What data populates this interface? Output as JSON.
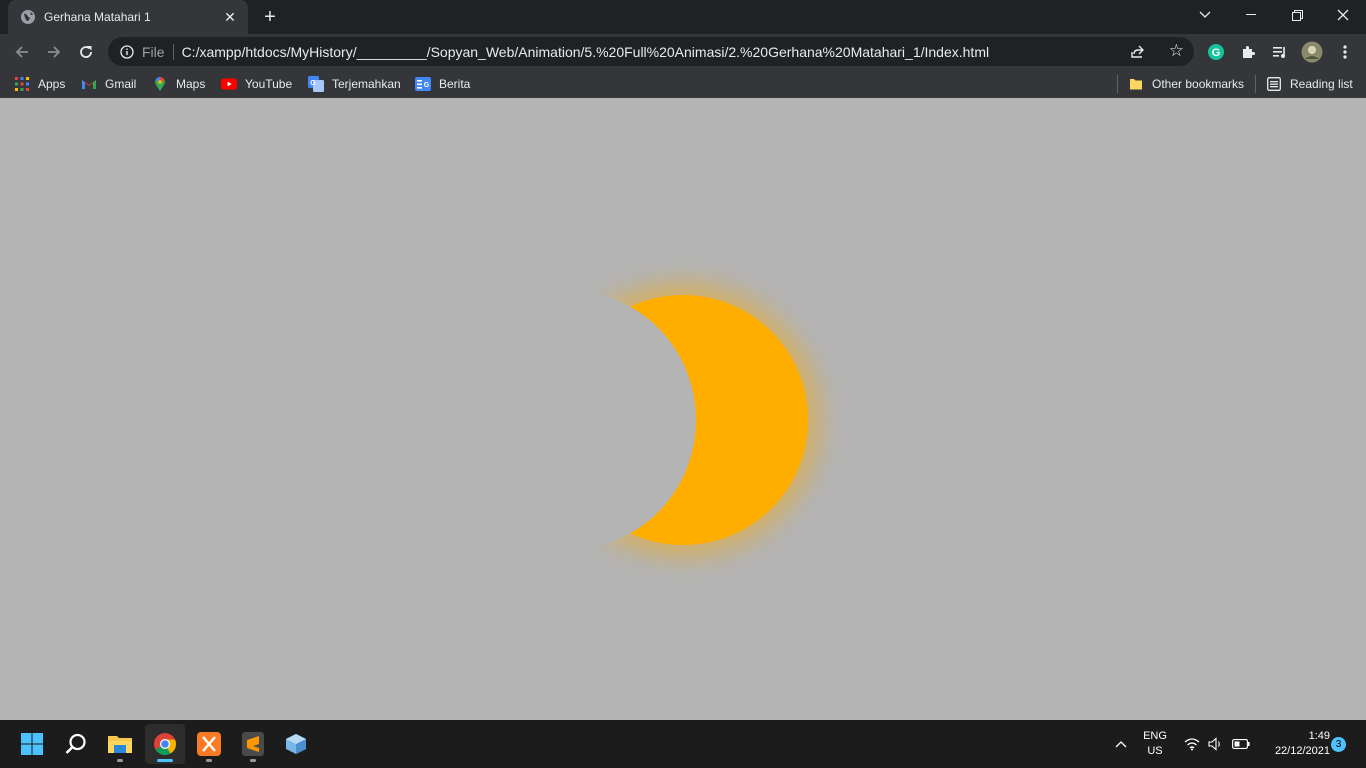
{
  "browser": {
    "tab": {
      "title": "Gerhana Matahari 1",
      "favicon": "globe-icon"
    },
    "omnibox": {
      "scheme": "File",
      "url": "C:/xampp/htdocs/MyHistory/_________/Sopyan_Web/Animation/5.%20Full%20Animasi/2.%20Gerhana%20Matahari_1/Index.html"
    },
    "bookmarks": [
      {
        "label": "Apps",
        "icon": "apps-grid-icon"
      },
      {
        "label": "Gmail",
        "icon": "gmail-icon"
      },
      {
        "label": "Maps",
        "icon": "maps-icon"
      },
      {
        "label": "YouTube",
        "icon": "youtube-icon"
      },
      {
        "label": "Terjemahkan",
        "icon": "translate-icon"
      },
      {
        "label": "Berita",
        "icon": "news-icon"
      }
    ],
    "other_bookmarks": "Other bookmarks",
    "reading_list": "Reading list",
    "extensions": [
      "grammarly-icon",
      "puzzle-icon",
      "media-control-icon",
      "profile-avatar-icon",
      "kebab-menu-icon"
    ]
  },
  "page": {
    "background_color": "#b4b4b4",
    "sun_color": "#ffae00",
    "moon_color": "#b4b4b4"
  },
  "taskbar": {
    "apps": [
      "windows-start-icon",
      "search-icon",
      "file-explorer-icon",
      "chrome-icon",
      "xampp-icon",
      "sublime-text-icon",
      "3d-box-icon"
    ],
    "active_app": "chrome-icon",
    "language": {
      "line1": "ENG",
      "line2": "US"
    },
    "clock": {
      "time": "1:49",
      "date": "22/12/2021"
    },
    "notification_count": "3"
  }
}
